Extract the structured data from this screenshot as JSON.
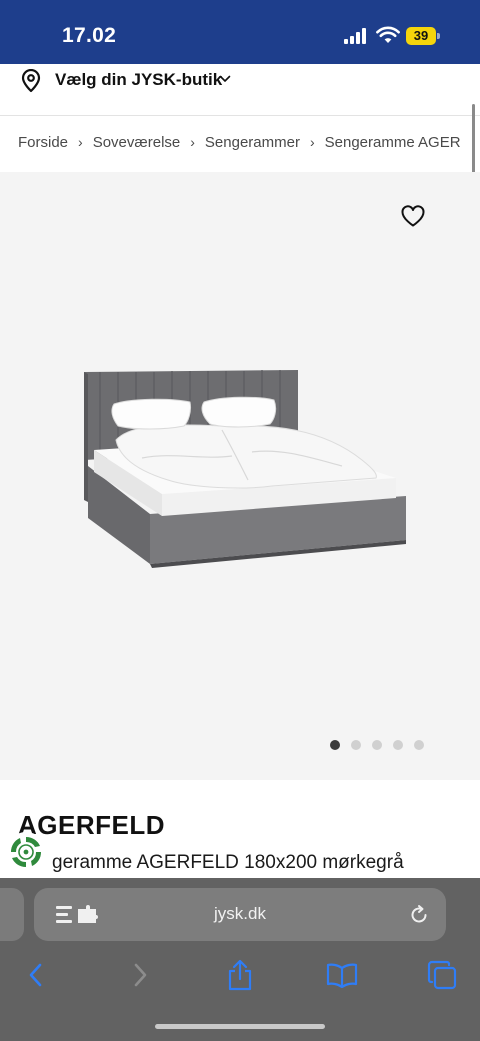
{
  "status": {
    "time": "17.02",
    "battery": "39",
    "battery_color": "#f5d50b",
    "bar_color": "#1e3e8c"
  },
  "store_selector": {
    "label": "Vælg din JYSK-butik",
    "icon": "location-pin-icon"
  },
  "breadcrumb": [
    "Forside",
    "Soveværelse",
    "Sengerammer",
    "Sengeramme AGER"
  ],
  "gallery": {
    "slide_count": 5,
    "active_index": 0,
    "image": "upholstered-bed-dark-grey",
    "favorite_icon": "heart-outline-icon"
  },
  "product": {
    "brand": "AGERFELD",
    "name": "geramme AGERFELD 180x200 mørkegrå"
  },
  "browser": {
    "url": "jysk.dk",
    "icons": [
      "page-settings-icon",
      "reload-icon",
      "back-icon",
      "forward-icon",
      "share-icon",
      "bookmarks-icon",
      "tabs-icon"
    ],
    "accent": "#2f7df6"
  }
}
